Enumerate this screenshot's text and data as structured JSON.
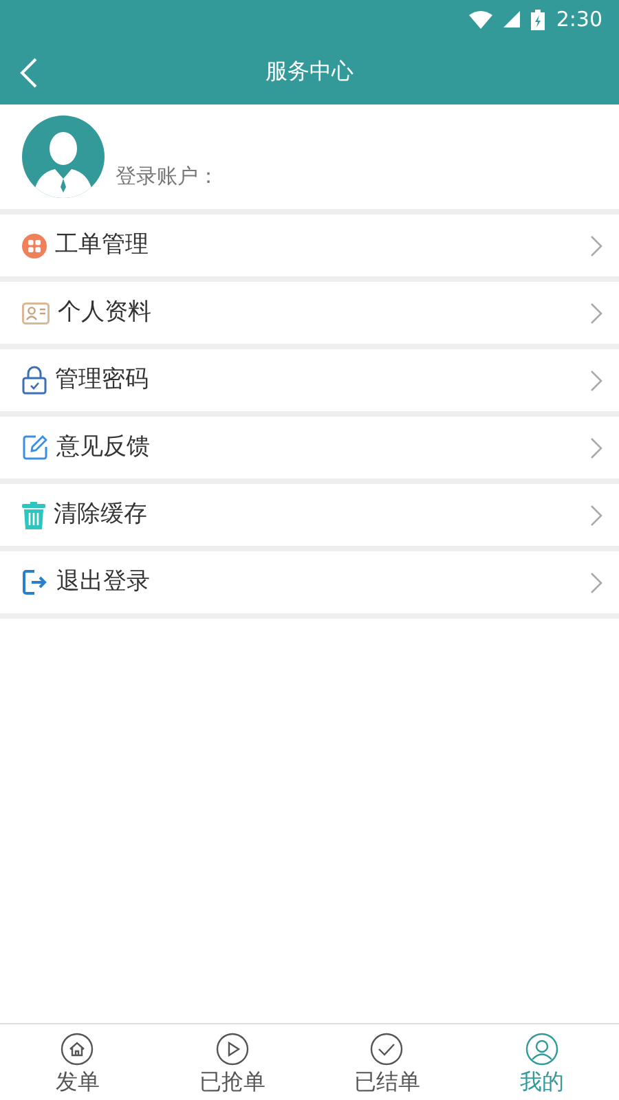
{
  "status_bar": {
    "time": "2:30"
  },
  "header": {
    "title": "服务中心"
  },
  "profile": {
    "account_label": "登录账户："
  },
  "menu": [
    {
      "kind": "orders",
      "label": "工单管理"
    },
    {
      "kind": "profile",
      "label": "个人资料"
    },
    {
      "kind": "password",
      "label": "管理密码"
    },
    {
      "kind": "feedback",
      "label": "意见反馈"
    },
    {
      "kind": "cache",
      "label": "清除缓存"
    },
    {
      "kind": "logout",
      "label": "退出登录"
    }
  ],
  "tabs": [
    {
      "kind": "home",
      "label": "发单",
      "selected": false
    },
    {
      "kind": "grab",
      "label": "已抢单",
      "selected": false
    },
    {
      "kind": "done",
      "label": "已结单",
      "selected": false
    },
    {
      "kind": "mine",
      "label": "我的",
      "selected": true
    }
  ]
}
